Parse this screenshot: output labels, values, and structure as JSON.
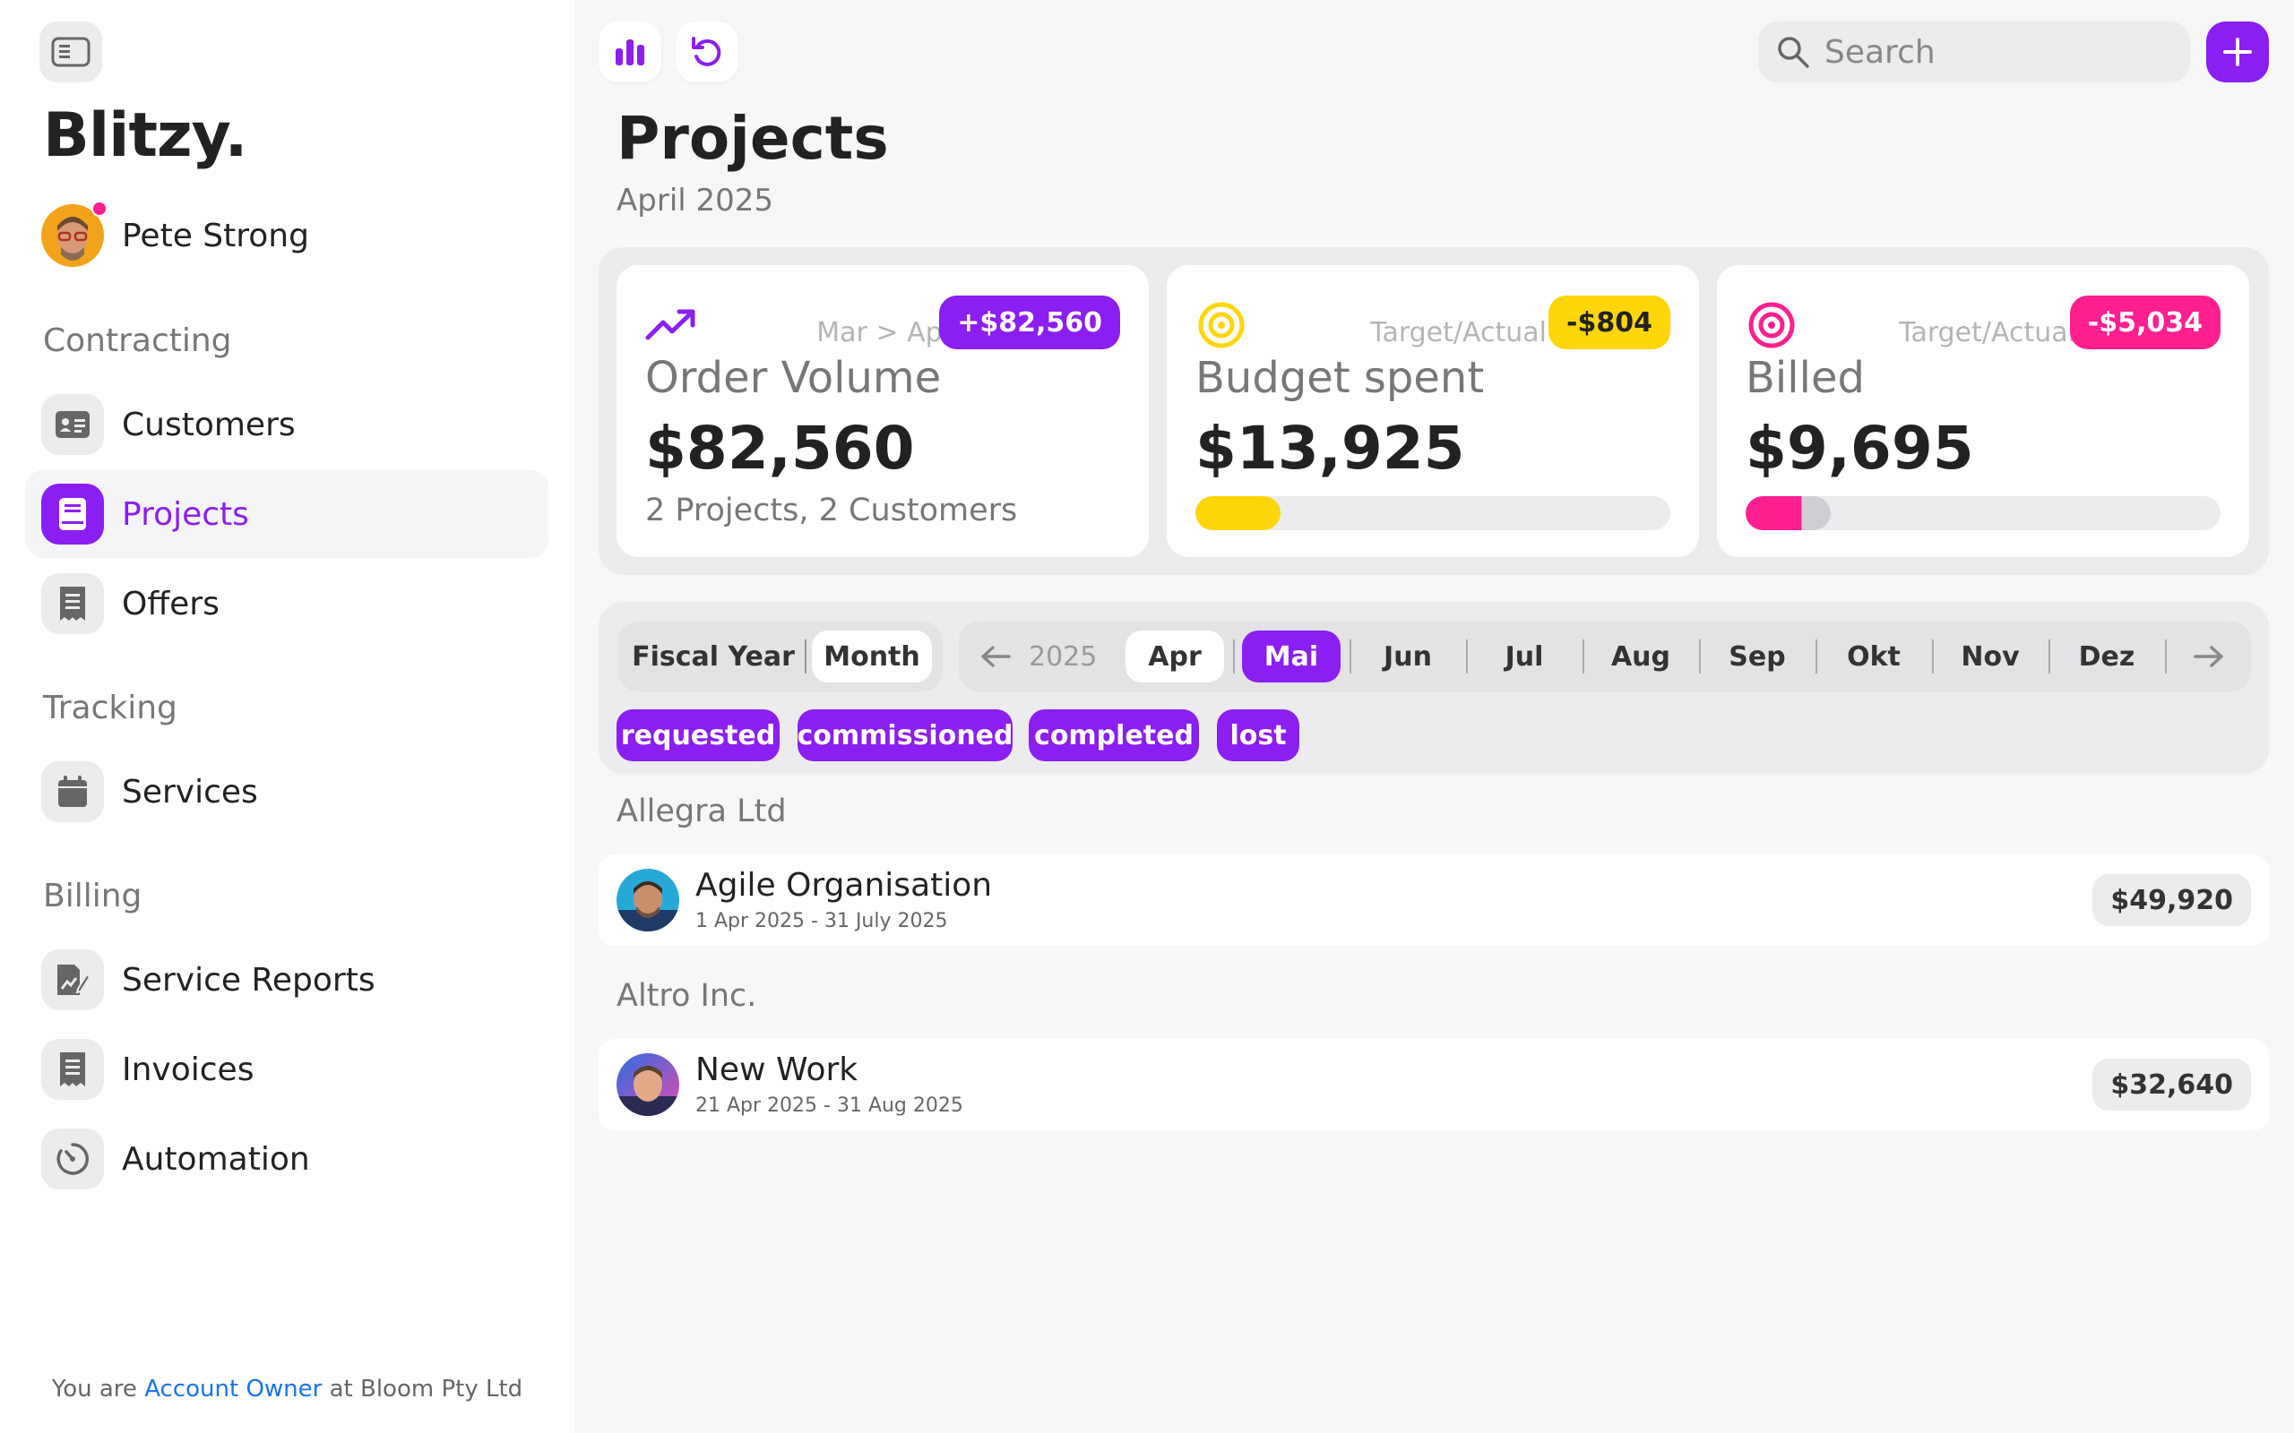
{
  "app": {
    "logo": "Blitzy.",
    "user_name": "Pete Strong"
  },
  "sidebar": {
    "sections": [
      {
        "label": "Contracting"
      },
      {
        "label": "Tracking"
      },
      {
        "label": "Billing"
      }
    ],
    "items": [
      {
        "label": "Customers",
        "icon": "contact-card-icon"
      },
      {
        "label": "Projects",
        "icon": "book-icon",
        "active": true
      },
      {
        "label": "Offers",
        "icon": "receipt-icon"
      },
      {
        "label": "Services",
        "icon": "calendar-icon"
      },
      {
        "label": "Service Reports",
        "icon": "report-edit-icon"
      },
      {
        "label": "Invoices",
        "icon": "invoice-icon"
      },
      {
        "label": "Automation",
        "icon": "timer-icon"
      }
    ],
    "footer": {
      "prefix": "You are",
      "role": "Account Owner",
      "suffix": "at Bloom Pty Ltd"
    }
  },
  "topbar": {
    "search_placeholder": "Search"
  },
  "page": {
    "title": "Projects",
    "subtitle": "April 2025"
  },
  "kpis": [
    {
      "comparison": "Mar > Apr",
      "badge": "+$82,560",
      "title": "Order Volume",
      "value": "$82,560",
      "sub": "2 Projects, 2 Customers",
      "icon": "trend-up-icon"
    },
    {
      "comparison": "Target/Actual",
      "badge": "-$804",
      "title": "Budget spent",
      "value": "$13,925",
      "progress": 0.18,
      "icon": "target-icon"
    },
    {
      "comparison": "Target/Actual",
      "badge": "-$5,034",
      "title": "Billed",
      "value": "$9,695",
      "progress": 0.18,
      "icon": "target-icon"
    }
  ],
  "filters": {
    "period_tabs": [
      "Fiscal Year",
      "Month"
    ],
    "selected_period": "Month",
    "year": "2025",
    "months": [
      "Apr",
      "Mai",
      "Jun",
      "Jul",
      "Aug",
      "Sep",
      "Okt",
      "Nov",
      "Dez"
    ],
    "status_chips": [
      "requested",
      "commissioned",
      "completed",
      "lost"
    ]
  },
  "groups": [
    {
      "customer": "Allegra Ltd",
      "projects": [
        {
          "title": "Agile Organisation",
          "dates": "1 Apr 2025 - 31 July 2025",
          "amount": "$49,920"
        }
      ]
    },
    {
      "customer": "Altro Inc.",
      "projects": [
        {
          "title": "New Work",
          "dates": "21 Apr 2025 - 31 Aug 2025",
          "amount": "$32,640"
        }
      ]
    }
  ],
  "colors": {
    "accent": "#8b1ef0",
    "yellow": "#ffd60a",
    "pink": "#ff1f8e"
  }
}
